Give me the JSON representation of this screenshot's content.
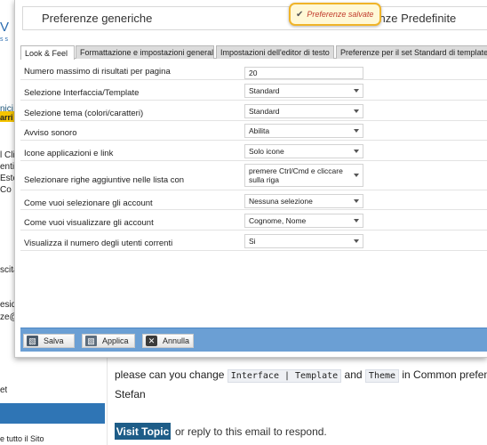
{
  "background": {
    "sidebar_fragments": [
      "V",
      "s s",
      "nici S",
      "arri",
      "l Cli",
      "enti",
      "Este",
      "Co",
      "scita",
      "eside",
      "ze@",
      "et",
      "e tutto il Sito"
    ],
    "email_text_before": "please can you change",
    "code_interface": "Interface | Template",
    "email_text_and": "and",
    "code_theme": "Theme",
    "email_text_after": "in Common prefences to Star",
    "signature": "Stefan",
    "visit_topic_label": "Visit Topic",
    "reply_text": "or reply to this email to respond."
  },
  "dialog": {
    "title": "Preferenze generiche",
    "title_right": "renze Predefinite",
    "toast": {
      "icon": "check-icon",
      "text": "Preferenze salvate"
    },
    "tabs": [
      {
        "label": "Look & Feel",
        "active": true
      },
      {
        "label": "Formattazione e impostazioni generali",
        "active": false
      },
      {
        "label": "Impostazioni dell'editor di testo",
        "active": false
      },
      {
        "label": "Preferenze per il set Standard di template",
        "active": false
      }
    ],
    "rows": [
      {
        "label": "Numero massimo di risultati per pagina",
        "value": "20",
        "kind": "input"
      },
      {
        "label": "Selezione Interfaccia/Template",
        "value": "Standard",
        "kind": "select"
      },
      {
        "label": "Selezione tema (colori/caratteri)",
        "value": "Standard",
        "kind": "select"
      },
      {
        "label": "Avviso sonoro",
        "value": "Abilita",
        "kind": "select"
      },
      {
        "label": "Icone applicazioni e link",
        "value": "Solo icone",
        "kind": "select"
      },
      {
        "label": "Selezionare righe aggiuntive nelle lista con",
        "value": "premere Ctrl/Cmd e cliccare sulla riga",
        "kind": "select"
      },
      {
        "label": "Come vuoi selezionare gli account",
        "value": "Nessuna selezione",
        "kind": "select"
      },
      {
        "label": "Come vuoi visualizzare gli account",
        "value": "Cognome, Nome",
        "kind": "select"
      },
      {
        "label": "Visualizza il numero degli utenti correnti",
        "value": "Si",
        "kind": "select"
      }
    ],
    "buttons": {
      "save": "Salva",
      "apply": "Applica",
      "cancel": "Annulla"
    },
    "colors": {
      "footer": "#6b9fd4",
      "toast_border": "#f0b429",
      "toast_text": "#c0392b",
      "visit_button": "#1e5d88"
    }
  }
}
